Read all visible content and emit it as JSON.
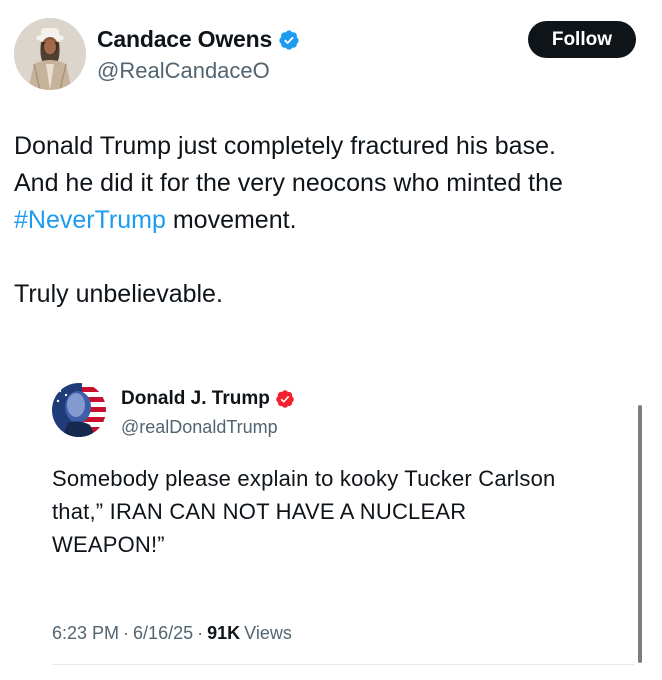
{
  "author": {
    "name": "Candace Owens",
    "handle": "@RealCandaceO",
    "verified_icon": "verified-badge-icon",
    "avatar": "profile-photo"
  },
  "follow_button": {
    "label": "Follow"
  },
  "tweet": {
    "line1": "Donald Trump just completely fractured his base.",
    "line2_prefix": "And he did it for the very neocons who minted the",
    "hashtag": "#NeverTrump",
    "line3_suffix": " movement.",
    "line4": "Truly unbelievable."
  },
  "quoted": {
    "name": "Donald J. Trump",
    "handle": "@realDonaldTrump",
    "verified_icon": "verified-badge-icon",
    "avatar": "profile-photo",
    "text_line1": "Somebody please explain to kooky Tucker Carlson",
    "text_line2": "that,” IRAN CAN NOT HAVE A NUCLEAR",
    "text_line3": "WEAPON!”",
    "time": "6:23 PM",
    "separator": "·",
    "date": "6/16/25",
    "views_count": "91K",
    "views_label": "Views"
  },
  "colors": {
    "text": "#0f1419",
    "secondary": "#536471",
    "link": "#1d9bf0",
    "verified_blue": "#1d9bf0",
    "verified_red": "#f4212e",
    "button_bg": "#0f1419"
  }
}
